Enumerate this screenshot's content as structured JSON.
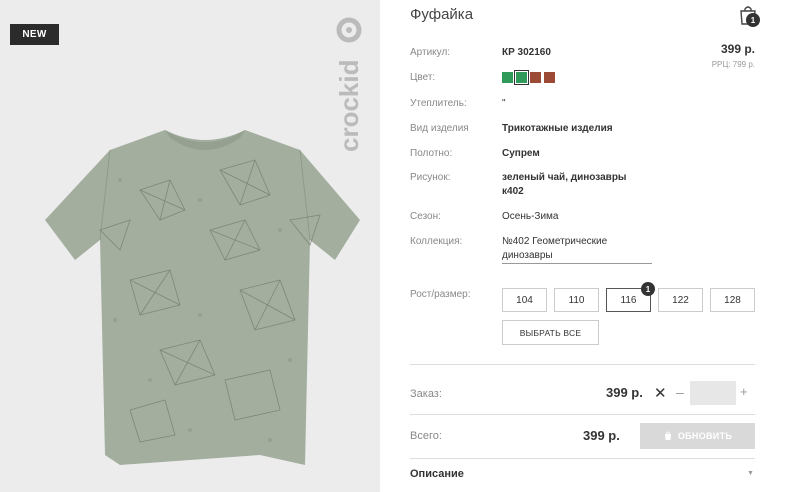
{
  "badge": "NEW",
  "brand": "crockid",
  "product": {
    "title": "Фуфайка",
    "price": "399 р.",
    "rrp": "РРЦ: 799 р."
  },
  "cart": {
    "count": "1"
  },
  "specs": {
    "article_label": "Артикул:",
    "article_value": "КР 302160",
    "color_label": "Цвет:",
    "insulation_label": "Утеплитель:",
    "insulation_value": "\"",
    "type_label": "Вид изделия",
    "type_value": "Трикотажные изделия",
    "fabric_label": "Полотно:",
    "fabric_value": "Супрем",
    "pattern_label": "Рисунок:",
    "pattern_value_1": "зеленый чай, динозавры",
    "pattern_value_2": "к402",
    "season_label": "Сезон:",
    "season_value": "Осень-Зима",
    "collection_label": "Коллекция:",
    "collection_value_1": "№402 Геометрические",
    "collection_value_2": "динозавры"
  },
  "swatches": [
    {
      "color": "#2f9a5a",
      "selected": false
    },
    {
      "color": "#2f9a5a",
      "selected": true
    },
    {
      "color": "#9a4a35",
      "selected": false
    },
    {
      "color": "#9a4a35",
      "selected": false
    }
  ],
  "sizes": {
    "label": "Рост/размер:",
    "options": [
      "104",
      "110",
      "116",
      "122",
      "128"
    ],
    "selected": "116",
    "selected_count": "1",
    "select_all": "ВЫБРАТЬ ВСЕ"
  },
  "order": {
    "label": "Заказ:",
    "price": "399 р.",
    "times": "✕",
    "minus": "–",
    "plus": "+",
    "quantity": ""
  },
  "total": {
    "label": "Всего:",
    "price": "399 р.",
    "update_button": "ОБНОВИТЬ"
  },
  "description": {
    "title": "Описание",
    "arrow": "▼"
  },
  "colors": {
    "shirt": "#a3ae9f",
    "shirt_shadow": "#95a091",
    "badge_bg": "#2b2b2b",
    "button_disabled": "#d9d9d9"
  }
}
